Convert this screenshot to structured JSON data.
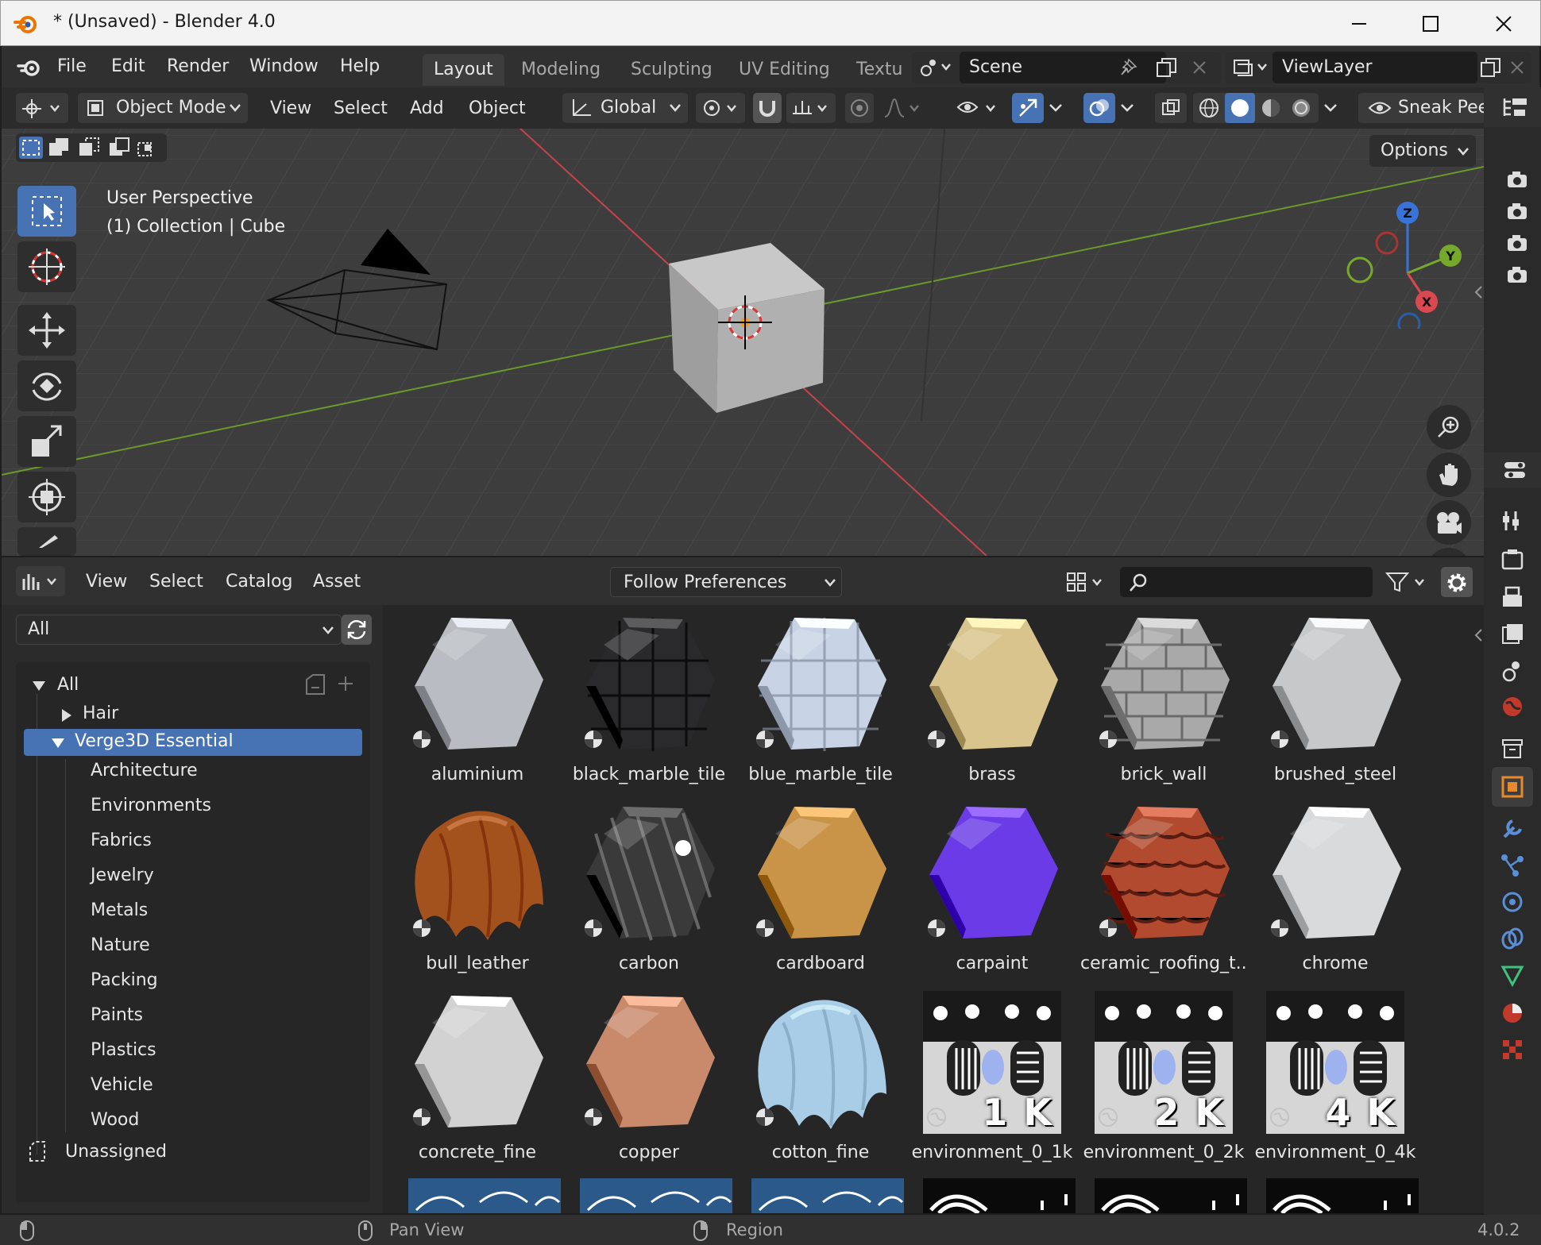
{
  "window": {
    "title": "* (Unsaved) - Blender 4.0"
  },
  "topbar": {
    "menus": [
      "File",
      "Edit",
      "Render",
      "Window",
      "Help"
    ],
    "workspaces": [
      "Layout",
      "Modeling",
      "Sculpting",
      "UV Editing",
      "Textu"
    ],
    "scene": "Scene",
    "view_layer": "ViewLayer"
  },
  "viewport": {
    "mode": "Object Mode",
    "menus": [
      "View",
      "Select",
      "Add",
      "Object"
    ],
    "orientation": "Global",
    "sneak_peek": "Sneak Pee",
    "options": "Options",
    "overlay_line1": "User Perspective",
    "overlay_line2": "(1) Collection | Cube",
    "gizmo": {
      "x": "X",
      "y": "Y",
      "z": "Z"
    },
    "colors": {
      "x_axis": "#d9494f",
      "y_axis": "#76a82b",
      "z_axis": "#3874d8",
      "bg": "#3d3d3d"
    }
  },
  "browser": {
    "menus": [
      "View",
      "Select",
      "Catalog",
      "Asset"
    ],
    "import_method": "Follow Preferences",
    "library": "All",
    "search_placeholder": "",
    "tree": {
      "root": "All",
      "hair": "Hair",
      "selected": "Verge3D Essential",
      "children": [
        "Architecture",
        "Environments",
        "Fabrics",
        "Jewelry",
        "Metals",
        "Nature",
        "Packing",
        "Paints",
        "Plastics",
        "Vehicle",
        "Wood"
      ],
      "unassigned": "Unassigned"
    },
    "assets": [
      {
        "name": "aluminium",
        "kind": "hex",
        "color": "#b9bcc2"
      },
      {
        "name": "black_marble_tile",
        "kind": "tile",
        "color": "#2a2a2c"
      },
      {
        "name": "blue_marble_tile",
        "kind": "tile",
        "color": "#c9d3e6"
      },
      {
        "name": "brass",
        "kind": "hex",
        "color": "#d8c48c"
      },
      {
        "name": "brick_wall",
        "kind": "brick",
        "color": "#a9a9a9"
      },
      {
        "name": "brushed_steel",
        "kind": "hex",
        "color": "#c7c8ca"
      },
      {
        "name": "bull_leather",
        "kind": "cloth",
        "color": "#a3521e"
      },
      {
        "name": "carbon",
        "kind": "carbon",
        "color": "#3a3a3a"
      },
      {
        "name": "cardboard",
        "kind": "hex",
        "color": "#c99448"
      },
      {
        "name": "carpaint",
        "kind": "hex",
        "color": "#6a3be6"
      },
      {
        "name": "ceramic_roofing_t...",
        "kind": "roof",
        "color": "#b14a2e"
      },
      {
        "name": "chrome",
        "kind": "hex",
        "color": "#d8dadc"
      },
      {
        "name": "concrete_fine",
        "kind": "hex",
        "color": "#d2d2d2"
      },
      {
        "name": "copper",
        "kind": "hex",
        "color": "#c98a6c"
      },
      {
        "name": "cotton_fine",
        "kind": "cloth",
        "color": "#a9cde6"
      },
      {
        "name": "environment_0_1k",
        "kind": "env",
        "res": "1 K"
      },
      {
        "name": "environment_0_2k",
        "kind": "env",
        "res": "2 K"
      },
      {
        "name": "environment_0_4k",
        "kind": "env",
        "res": "4 K"
      }
    ]
  },
  "status": {
    "pan": "Pan View",
    "region": "Region",
    "version": "4.0.2"
  }
}
